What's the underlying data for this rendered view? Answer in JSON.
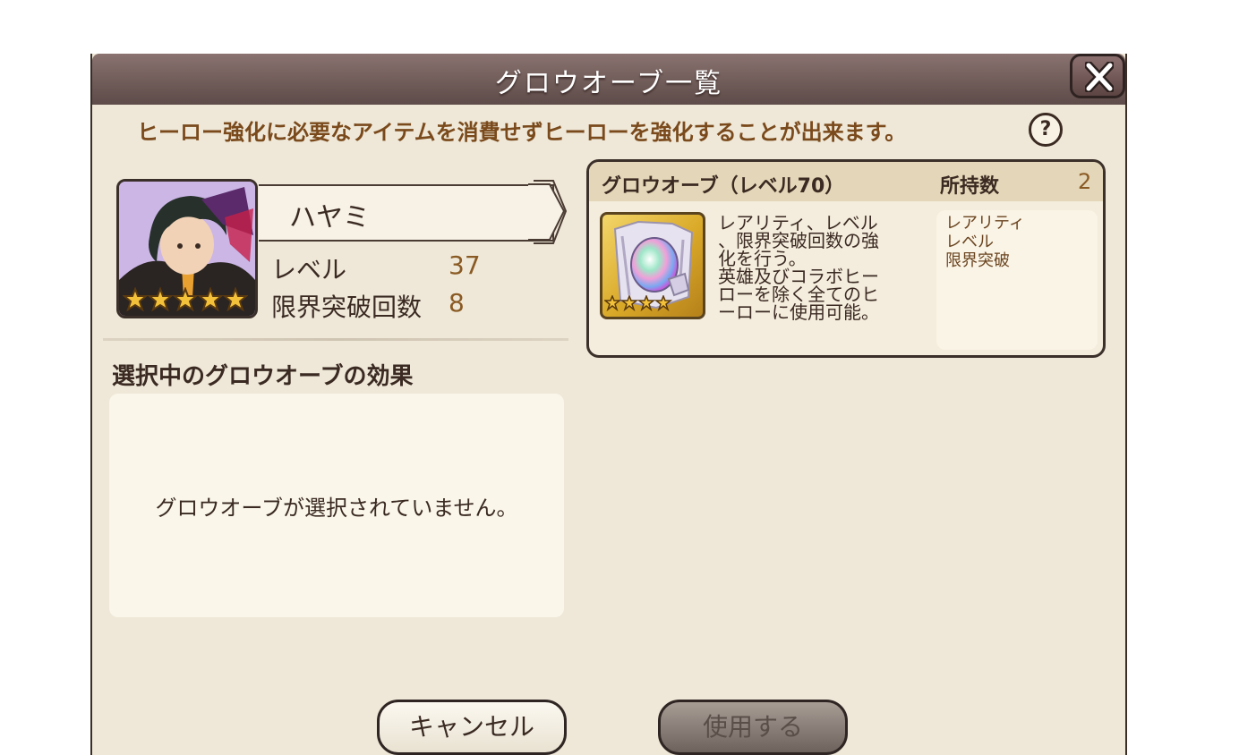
{
  "dialog": {
    "title": "グロウオーブ一覧",
    "subtitle": "ヒーロー強化に必要なアイテムを消費せずヒーローを強化することが出来ます。",
    "help_label": "?"
  },
  "hero": {
    "name": "ハヤミ",
    "level_label": "レベル",
    "level_value": "37",
    "limit_label": "限界突破回数",
    "limit_value": "8",
    "stars": 5
  },
  "effect": {
    "heading": "選択中のグロウオーブの効果",
    "empty_text": "グロウオーブが選択されていません。"
  },
  "orb": {
    "name": "グロウオーブ（レベル70）",
    "owned_label": "所持数",
    "owned_count": "2",
    "stars": 4,
    "description_lines": [
      "レアリティ、レベル",
      "、限界突破回数の強",
      "化を行う。",
      "英雄及びコラボヒー",
      "ローを除く全てのヒ",
      "ーローに使用可能。"
    ],
    "tags": [
      "レアリティ",
      "レベル",
      "限界突破"
    ]
  },
  "buttons": {
    "cancel_label": "キャンセル",
    "use_label": "使用する"
  },
  "colors": {
    "title_bar": "#6e5a57",
    "panel_bg": "#efe8d8",
    "accent_brown": "#8a5a24",
    "subtitle": "#7a4a1c",
    "star_gold": "#f3c23a"
  }
}
